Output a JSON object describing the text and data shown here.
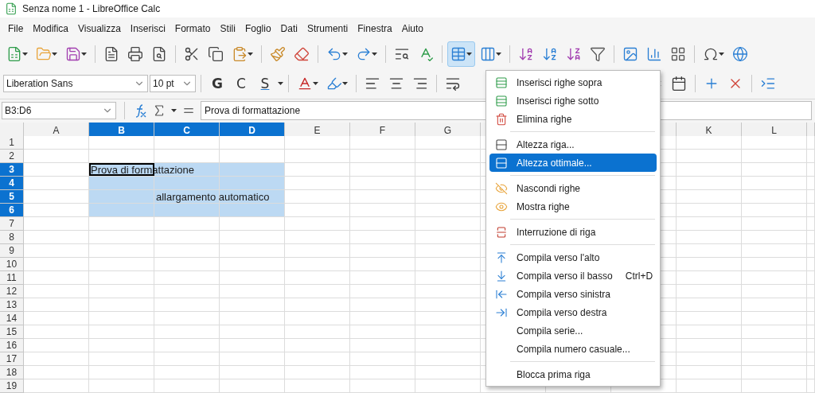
{
  "window": {
    "title": "Senza nome 1 - LibreOffice Calc"
  },
  "menubar": [
    "File",
    "Modifica",
    "Visualizza",
    "Inserisci",
    "Formato",
    "Stili",
    "Foglio",
    "Dati",
    "Strumenti",
    "Finestra",
    "Aiuto"
  ],
  "formatting": {
    "font_name": "Liberation Sans",
    "font_size": "10 pt",
    "style_buttons": [
      "G",
      "C",
      "S"
    ]
  },
  "formula_bar": {
    "name_box": "B3:D6",
    "content": "Prova di formattazione"
  },
  "columns": [
    {
      "label": "A",
      "selected": false
    },
    {
      "label": "B",
      "selected": true
    },
    {
      "label": "C",
      "selected": true
    },
    {
      "label": "D",
      "selected": true
    },
    {
      "label": "E",
      "selected": false
    },
    {
      "label": "F",
      "selected": false
    },
    {
      "label": "G",
      "selected": false
    },
    {
      "label": "K",
      "selected": false
    },
    {
      "label": "L",
      "selected": false
    }
  ],
  "rows": [
    {
      "label": "1",
      "selected": false
    },
    {
      "label": "2",
      "selected": false
    },
    {
      "label": "3",
      "selected": true,
      "cells": [
        null,
        {
          "text": "Prova di formattazione",
          "active": true
        }
      ]
    },
    {
      "label": "4",
      "selected": true
    },
    {
      "label": "5",
      "selected": true,
      "cells": [
        null,
        null,
        {
          "text": "allargamento automatico",
          "active": false
        }
      ]
    },
    {
      "label": "6",
      "selected": true
    },
    {
      "label": "7",
      "selected": false
    },
    {
      "label": "8",
      "selected": false
    },
    {
      "label": "9",
      "selected": false
    },
    {
      "label": "10",
      "selected": false
    },
    {
      "label": "11",
      "selected": false
    },
    {
      "label": "12",
      "selected": false
    },
    {
      "label": "13",
      "selected": false
    },
    {
      "label": "14",
      "selected": false
    },
    {
      "label": "15",
      "selected": false
    },
    {
      "label": "16",
      "selected": false
    },
    {
      "label": "17",
      "selected": false
    },
    {
      "label": "18",
      "selected": false
    },
    {
      "label": "19",
      "selected": false
    }
  ],
  "rows_menu": {
    "open": true,
    "items": [
      {
        "kind": "item",
        "label": "Inserisci righe sopra",
        "selected": false
      },
      {
        "kind": "item",
        "label": "Inserisci righe sotto",
        "selected": false
      },
      {
        "kind": "item",
        "label": "Elimina righe",
        "selected": false
      },
      {
        "kind": "separator"
      },
      {
        "kind": "item",
        "label": "Altezza riga...",
        "selected": false
      },
      {
        "kind": "item",
        "label": "Altezza ottimale...",
        "selected": true
      },
      {
        "kind": "separator"
      },
      {
        "kind": "item",
        "label": "Nascondi righe",
        "selected": false
      },
      {
        "kind": "item",
        "label": "Mostra righe",
        "selected": false
      },
      {
        "kind": "separator"
      },
      {
        "kind": "item",
        "label": "Interruzione di riga",
        "selected": false
      },
      {
        "kind": "separator"
      },
      {
        "kind": "item",
        "label": "Compila verso l'alto",
        "selected": false
      },
      {
        "kind": "item",
        "label": "Compila verso il basso",
        "shortcut": "Ctrl+D",
        "selected": false
      },
      {
        "kind": "item",
        "label": "Compila verso sinistra",
        "selected": false
      },
      {
        "kind": "item",
        "label": "Compila verso destra",
        "selected": false
      },
      {
        "kind": "item",
        "label": "Compila serie...",
        "selected": false
      },
      {
        "kind": "item",
        "label": "Compila numero casuale...",
        "selected": false
      },
      {
        "kind": "separator"
      },
      {
        "kind": "item",
        "label": "Blocca prima riga",
        "selected": false
      }
    ]
  }
}
